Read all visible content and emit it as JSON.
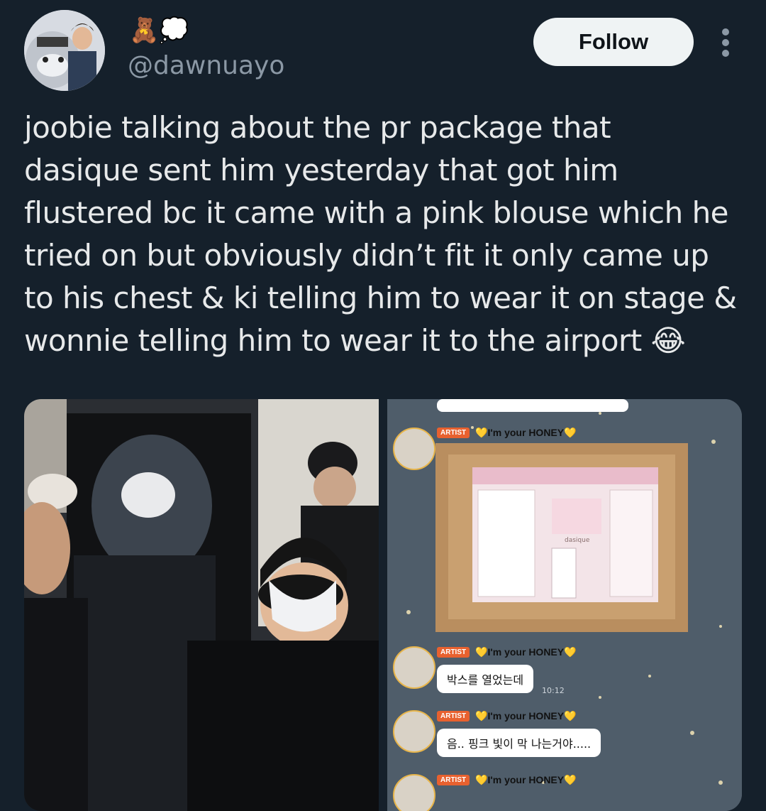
{
  "header": {
    "emoji": "🧸💭",
    "handle": "@dawnuayo",
    "follow_label": "Follow",
    "more_icon": "more-vertical-icon"
  },
  "tweet": {
    "text": "joobie talking about the pr package that\ndasique sent him yesterday that got him\nflustered bc it came with a pink blouse which he\ntried on but obviously didn’t fit it only came up\nto his chest & ki telling him to wear it on stage &\nwonnie telling him to wear it to the airport 😂"
  },
  "chat": {
    "artist_tag": "ARTIST",
    "sender": "💛I'm your HONEY💛",
    "box_label": "dasique",
    "messages": [
      {
        "text": "박스를 열었는데",
        "time": "10:12"
      },
      {
        "text": "음.. 핑크 빛이 막 나는거야....."
      }
    ]
  },
  "colors": {
    "background": "#15202b",
    "follow_bg": "#eff3f4",
    "handle": "#8b98a5"
  }
}
